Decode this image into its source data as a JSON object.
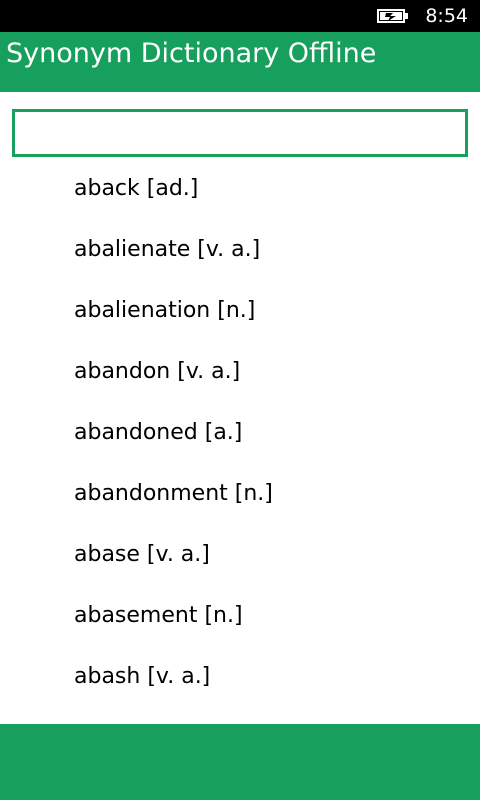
{
  "status_bar": {
    "time": "8:54",
    "battery_icon": "battery-charging-icon"
  },
  "header": {
    "title": "Synonym Dictionary Offline"
  },
  "search": {
    "value": ""
  },
  "words": [
    {
      "label": "aback [ad.]"
    },
    {
      "label": "abalienate [v. a.]"
    },
    {
      "label": "abalienation [n.]"
    },
    {
      "label": "abandon [v. a.]"
    },
    {
      "label": "abandoned [a.]"
    },
    {
      "label": "abandonment [n.]"
    },
    {
      "label": "abase [v. a.]"
    },
    {
      "label": "abasement [n.]"
    },
    {
      "label": "abash [v. a.]"
    }
  ],
  "colors": {
    "accent": "#17a05d",
    "status_bar": "#000000",
    "background": "#ffffff"
  }
}
